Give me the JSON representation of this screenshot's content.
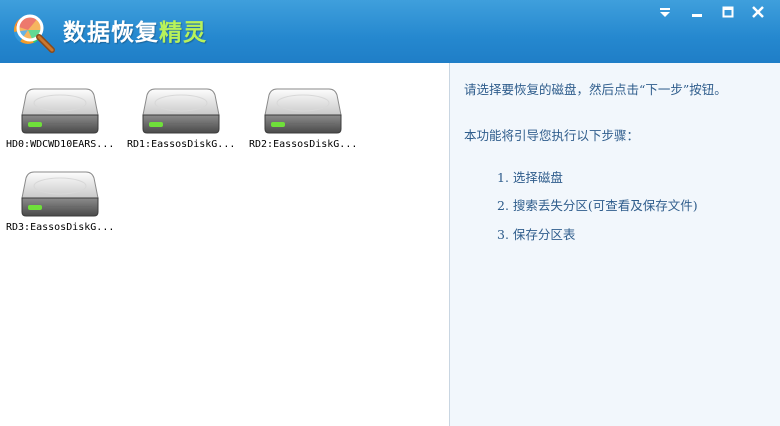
{
  "window": {
    "title_main": "数据恢复",
    "title_accent": "精灵",
    "colors": {
      "titlebar": "#2588cf",
      "accent": "#b8f25a",
      "instruction_text": "#2f5d8c"
    }
  },
  "icons": {
    "logo": "magnifier-ball-icon",
    "menu": "dropdown-arrow-icon",
    "minimize": "minimize-icon",
    "maximize": "maximize-icon",
    "close": "close-icon",
    "disk": "hard-disk-icon"
  },
  "disks": [
    {
      "label": "HD0:WDCWD10EARS..."
    },
    {
      "label": "RD1:EassosDiskG..."
    },
    {
      "label": "RD2:EassosDiskG..."
    },
    {
      "label": "RD3:EassosDiskG..."
    }
  ],
  "instructions": {
    "intro": "请选择要恢复的磁盘，然后点击“下一步”按钮。",
    "subtitle": "本功能将引导您执行以下步骤：",
    "steps": [
      "1. 选择磁盘",
      "2. 搜索丢失分区(可查看及保存文件)",
      "3. 保存分区表"
    ]
  }
}
